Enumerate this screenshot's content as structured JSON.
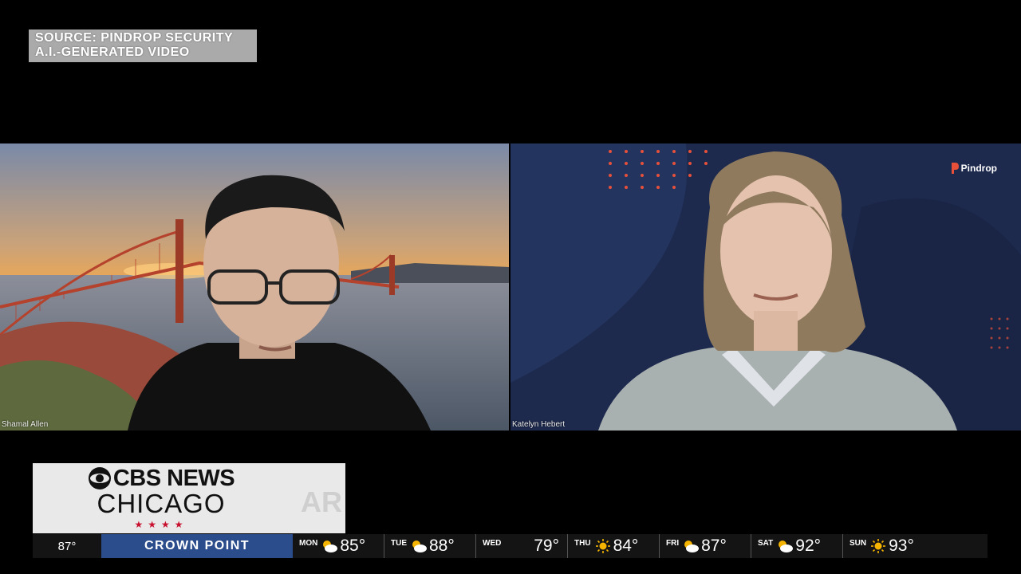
{
  "source_tag": {
    "line1": "SOURCE: PINDROP SECURITY",
    "line2": "A.I.-GENERATED VIDEO"
  },
  "video_call": {
    "left_participant_name": "Shamal Allen",
    "right_participant_name": "Katelyn Hebert",
    "brand_logo": "Pindrop"
  },
  "network": {
    "line1": "CBS NEWS",
    "line2": "CHICAGO",
    "stars": "★★★★",
    "ghost_text": "AR"
  },
  "ticker": {
    "current_temp": "87°",
    "location": "CROWN POINT",
    "forecast": [
      {
        "day": "MON",
        "icon": "partly-cloudy-icon",
        "temp": "85°"
      },
      {
        "day": "TUE",
        "icon": "partly-cloudy-icon",
        "temp": "88°"
      },
      {
        "day": "WED",
        "icon": "none",
        "temp": "79°"
      },
      {
        "day": "THU",
        "icon": "sun-icon",
        "temp": "84°"
      },
      {
        "day": "FRI",
        "icon": "partly-cloudy-icon",
        "temp": "87°"
      },
      {
        "day": "SAT",
        "icon": "partly-cloudy-icon",
        "temp": "92°"
      },
      {
        "day": "SUN",
        "icon": "sun-icon",
        "temp": "93°"
      }
    ]
  },
  "colors": {
    "ticker_location_bg": "#2b4d8c",
    "panel_right_bg": "#1d2a4e",
    "pindrop_accent": "#e8503a",
    "chicago_star_red": "#c8102e"
  }
}
